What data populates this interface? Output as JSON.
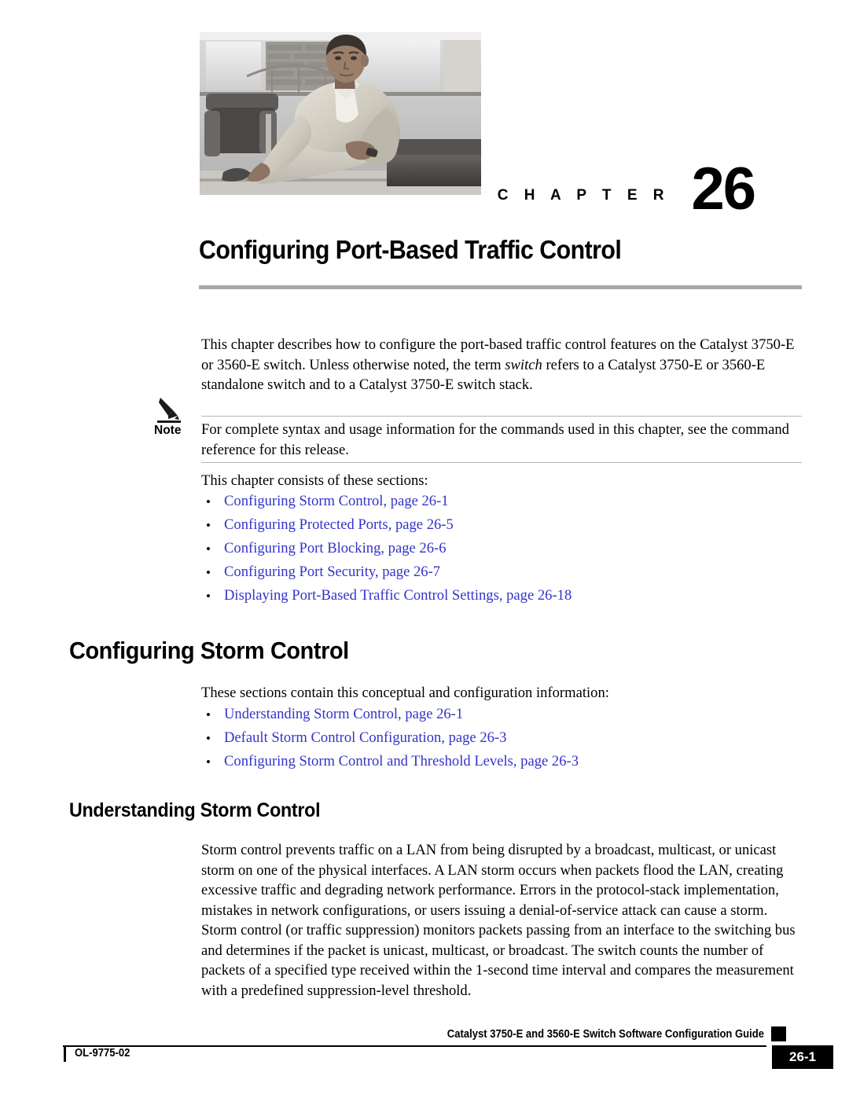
{
  "chapter": {
    "label_word": "C H A P T E R",
    "number": "26",
    "title": "Configuring Port-Based Traffic Control",
    "photo_alt": "chapter-opener-photo"
  },
  "intro": {
    "paragraph_prefix": "This chapter describes how to configure the port-based traffic control features on the Catalyst 3750-E or 3560-E switch. Unless otherwise noted, the term ",
    "paragraph_italic": "switch",
    "paragraph_suffix": " refers to a Catalyst 3750-E or 3560-E standalone switch and to a Catalyst 3750-E switch stack."
  },
  "note": {
    "label": "Note",
    "icon": "pencil-icon",
    "text": "For complete syntax and usage information for the commands used in this chapter, see the command reference for this release."
  },
  "sections_intro": {
    "lead": "This chapter consists of these sections:",
    "links": [
      {
        "label": "Configuring Storm Control, page 26-1"
      },
      {
        "label": "Configuring Protected Ports, page 26-5"
      },
      {
        "label": "Configuring Port Blocking, page 26-6"
      },
      {
        "label": "Configuring Port Security, page 26-7"
      },
      {
        "label": "Displaying Port-Based Traffic Control Settings, page 26-18"
      }
    ]
  },
  "storm_control": {
    "heading": "Configuring Storm Control",
    "lead": "These sections contain this conceptual and configuration information:",
    "links": [
      {
        "label": "Understanding Storm Control, page 26-1"
      },
      {
        "label": "Default Storm Control Configuration, page 26-3"
      },
      {
        "label": "Configuring Storm Control and Threshold Levels, page 26-3"
      }
    ]
  },
  "understanding": {
    "heading": "Understanding Storm Control",
    "paragraph_1": "Storm control prevents traffic on a LAN from being disrupted by a broadcast, multicast, or unicast storm on one of the physical interfaces. A LAN storm occurs when packets flood the LAN, creating excessive traffic and degrading network performance. Errors in the protocol-stack implementation, mistakes in network configurations, or users issuing a denial-of-service attack can cause a storm.",
    "paragraph_2": "Storm control (or traffic suppression) monitors packets passing from an interface to the switching bus and determines if the packet is unicast, multicast, or broadcast. The switch counts the number of packets of a specified type received within the 1-second time interval and compares the measurement with a predefined suppression-level threshold."
  },
  "footer": {
    "guide_title": "Catalyst 3750-E and 3560-E Switch Software Configuration Guide",
    "doc_id": "OL-9775-02",
    "page_number": "26-1"
  },
  "colors": {
    "link": "#3333cc",
    "rule_gray": "#a8a8a8",
    "note_rule": "#b6b6b6",
    "badge_bg": "#000000"
  }
}
